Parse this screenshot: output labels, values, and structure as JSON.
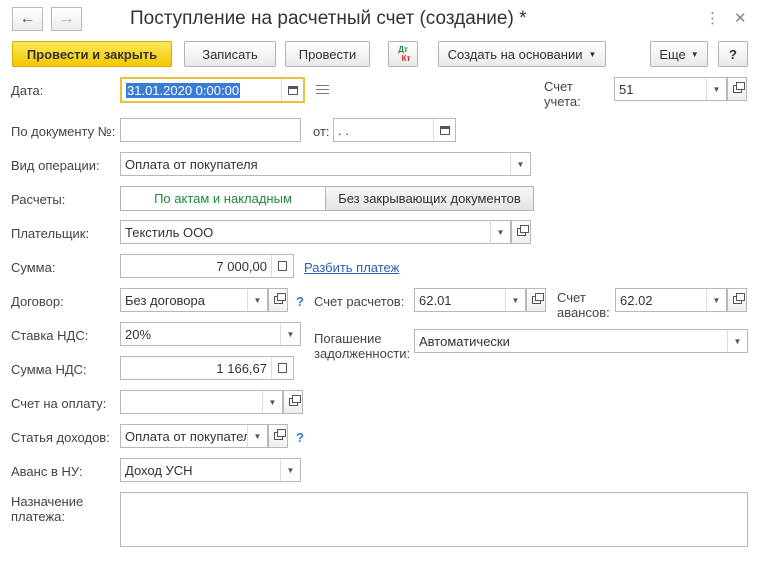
{
  "window": {
    "title": "Поступление на расчетный счет (создание) *"
  },
  "nav": {
    "back_icon": "←",
    "forward_icon": "→"
  },
  "toolbar": {
    "post_close": "Провести и закрыть",
    "save": "Записать",
    "post": "Провести",
    "dt_kt_top": "Дт",
    "dt_kt_bottom": "Кт",
    "create_based": "Создать на основании",
    "more": "Еще",
    "help": "?"
  },
  "form": {
    "date_label": "Дата:",
    "date_value": "31.01.2020  0:00:00",
    "account_label": "Счет учета:",
    "account_value": "51",
    "doc_no_label": "По документу №:",
    "doc_no_value": "",
    "from_label": "от:",
    "from_value": " .  .",
    "op_type_label": "Вид операции:",
    "op_type_value": "Оплата от покупателя",
    "settle_label": "Расчеты:",
    "settle_option_1": "По актам и накладным",
    "settle_option_2": "Без закрывающих документов",
    "payer_label": "Плательщик:",
    "payer_value": "Текстиль ООО",
    "sum_label": "Сумма:",
    "sum_value": "7 000,00",
    "split_link": "Разбить платеж",
    "contract_label": "Договор:",
    "contract_value": "Без договора",
    "settle_acc_label": "Счет расчетов:",
    "settle_acc_value": "62.01",
    "adv_acc_label": "Счет авансов:",
    "adv_acc_value": "62.02",
    "vat_rate_label": "Ставка НДС:",
    "vat_rate_value": "20%",
    "repay_label": "Погашение задолженности:",
    "repay_value": "Автоматически",
    "vat_sum_label": "Сумма НДС:",
    "vat_sum_value": "1 166,67",
    "invoice_label": "Счет на оплату:",
    "invoice_value": "",
    "income_label": "Статья доходов:",
    "income_value": "Оплата от покупател",
    "advance_tax_label": "Аванс в НУ:",
    "advance_tax_value": "Доход УСН",
    "purpose_label": "Назначение платежа:",
    "purpose_value": "",
    "q_mark": "?"
  },
  "colors": {
    "primary": "#f5cd0f",
    "link": "#2a62b3",
    "active_segment": "#1e8a3c",
    "focus": "#e8c33a"
  }
}
